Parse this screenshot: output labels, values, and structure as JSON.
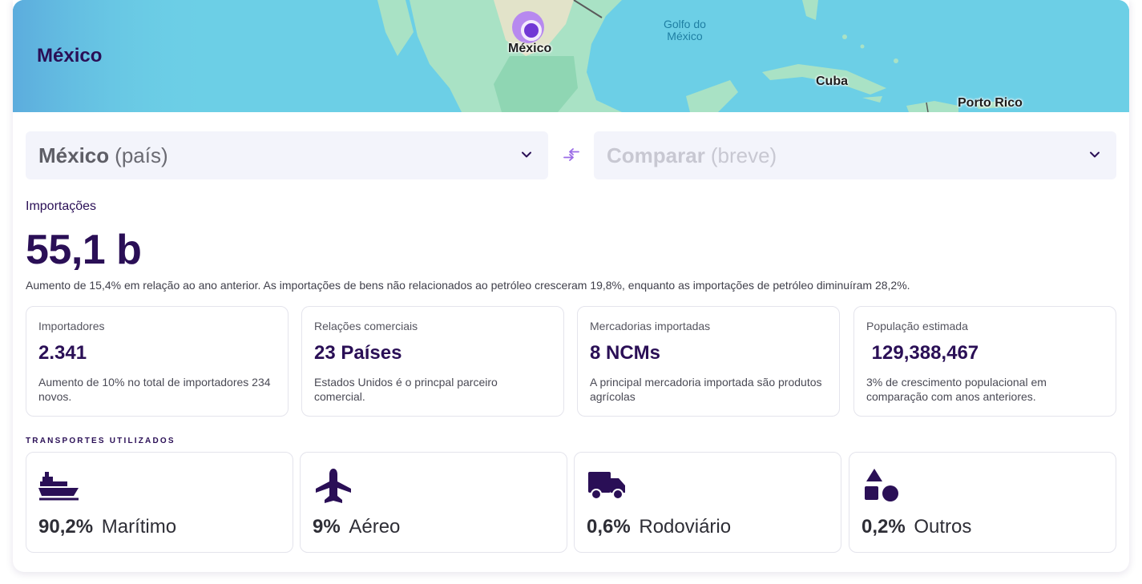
{
  "map": {
    "title": "México",
    "labels": {
      "mexico": "México",
      "gulf_line1": "Golfo do",
      "gulf_line2": "México",
      "cuba": "Cuba",
      "puerto_rico": "Porto Rico"
    }
  },
  "selectors": {
    "primary": {
      "name": "México",
      "type": "(país)"
    },
    "compare": {
      "name": "Comparar",
      "type": "(breve)"
    }
  },
  "imports": {
    "label": "Importações",
    "value": "55,1 b",
    "description": "Aumento de 15,4% em relação ao ano anterior. As importações de bens não relacionados ao petróleo cresceram 19,8%, enquanto as importações de petróleo diminuíram 28,2%."
  },
  "stats": [
    {
      "label": "Importadores",
      "value": "2.341",
      "note": "Aumento de 10% no total de importadores 234 novos."
    },
    {
      "label": "Relações comerciais",
      "value": "23 Países",
      "note": "Estados Unidos é o princpal parceiro comercial."
    },
    {
      "label": "Mercadorias importadas",
      "value": "8 NCMs",
      "note": "A principal mercadoria importada são produtos agrícolas"
    },
    {
      "label": "População estimada",
      "value": " 129,388,467",
      "note": "3% de crescimento populacional em comparação com anos anteriores."
    }
  ],
  "transport": {
    "label": "TRANSPORTES UTILIZADOS",
    "items": [
      {
        "icon": "ship-icon",
        "percent": "90,2%",
        "name": "Marítimo"
      },
      {
        "icon": "airplane-icon",
        "percent": "9%",
        "name": "Aéreo"
      },
      {
        "icon": "truck-icon",
        "percent": "0,6%",
        "name": "Rodoviário"
      },
      {
        "icon": "shapes-icon",
        "percent": "0,2%",
        "name": "Outros"
      }
    ]
  },
  "colors": {
    "primary": "#2a0f56",
    "accent": "#6c2fd6",
    "ocean": "#6ccfe6",
    "land": "#a8e0c4"
  }
}
